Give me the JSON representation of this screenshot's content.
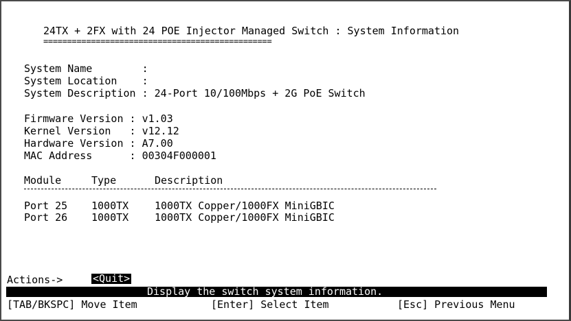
{
  "header": {
    "title": "24TX + 2FX with 24 POE Injector Managed Switch : System Information",
    "underline": "================================================"
  },
  "system": {
    "name_label": "System Name        :",
    "location_label": "System Location    :",
    "description_label": "System Description : 24-Port 10/100Mbps + 2G PoE Switch"
  },
  "versions": {
    "firmware": "Firmware Version : v1.03",
    "kernel": "Kernel Version   : v12.12",
    "hardware": "Hardware Version : A7.00",
    "mac": "MAC Address      : 00304F000001"
  },
  "module_table": {
    "headers": {
      "module": "Module",
      "type": "Type",
      "description": "Description"
    },
    "rows": [
      {
        "module": "Port 25",
        "type": "1000TX",
        "description": "1000TX Copper/1000FX MiniGBIC"
      },
      {
        "module": "Port 26",
        "type": "1000TX",
        "description": "1000TX Copper/1000FX MiniGBIC"
      }
    ]
  },
  "actions": {
    "label": "Actions->",
    "quit": "<Quit>"
  },
  "info_bar": {
    "text": "Display the switch system information."
  },
  "footer": {
    "move": "[TAB/BKSPC] Move Item",
    "select": "[Enter] Select Item",
    "previous": "[Esc] Previous Menu"
  }
}
